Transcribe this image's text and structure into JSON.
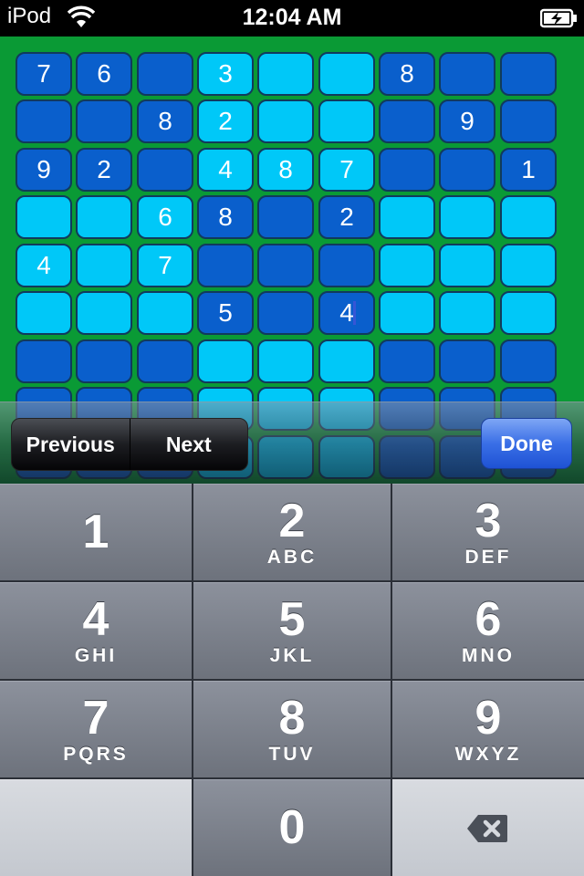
{
  "status_bar": {
    "device": "iPod",
    "time": "12:04 AM"
  },
  "board": {
    "rows": [
      [
        {
          "v": "7",
          "t": "d"
        },
        {
          "v": "6",
          "t": "d"
        },
        {
          "v": "",
          "t": "d"
        },
        {
          "v": "3",
          "t": "l"
        },
        {
          "v": "",
          "t": "l"
        },
        {
          "v": "",
          "t": "l"
        },
        {
          "v": "8",
          "t": "d"
        },
        {
          "v": "",
          "t": "d"
        },
        {
          "v": "",
          "t": "d"
        }
      ],
      [
        {
          "v": "",
          "t": "d"
        },
        {
          "v": "",
          "t": "d"
        },
        {
          "v": "8",
          "t": "d"
        },
        {
          "v": "2",
          "t": "l"
        },
        {
          "v": "",
          "t": "l"
        },
        {
          "v": "",
          "t": "l"
        },
        {
          "v": "",
          "t": "d"
        },
        {
          "v": "9",
          "t": "d"
        },
        {
          "v": "",
          "t": "d"
        }
      ],
      [
        {
          "v": "9",
          "t": "d"
        },
        {
          "v": "2",
          "t": "d"
        },
        {
          "v": "",
          "t": "d"
        },
        {
          "v": "4",
          "t": "l"
        },
        {
          "v": "8",
          "t": "l"
        },
        {
          "v": "7",
          "t": "l"
        },
        {
          "v": "",
          "t": "d"
        },
        {
          "v": "",
          "t": "d"
        },
        {
          "v": "1",
          "t": "d"
        }
      ],
      [
        {
          "v": "",
          "t": "l"
        },
        {
          "v": "",
          "t": "l"
        },
        {
          "v": "6",
          "t": "l"
        },
        {
          "v": "8",
          "t": "d"
        },
        {
          "v": "",
          "t": "d"
        },
        {
          "v": "2",
          "t": "d"
        },
        {
          "v": "",
          "t": "l"
        },
        {
          "v": "",
          "t": "l"
        },
        {
          "v": "",
          "t": "l"
        }
      ],
      [
        {
          "v": "4",
          "t": "l"
        },
        {
          "v": "",
          "t": "l"
        },
        {
          "v": "7",
          "t": "l"
        },
        {
          "v": "",
          "t": "d"
        },
        {
          "v": "",
          "t": "d"
        },
        {
          "v": "",
          "t": "d"
        },
        {
          "v": "",
          "t": "l"
        },
        {
          "v": "",
          "t": "l"
        },
        {
          "v": "",
          "t": "l"
        }
      ],
      [
        {
          "v": "",
          "t": "l"
        },
        {
          "v": "",
          "t": "l"
        },
        {
          "v": "",
          "t": "l"
        },
        {
          "v": "5",
          "t": "d"
        },
        {
          "v": "",
          "t": "d"
        },
        {
          "v": "4",
          "t": "d",
          "active": true
        },
        {
          "v": "",
          "t": "l"
        },
        {
          "v": "",
          "t": "l"
        },
        {
          "v": "",
          "t": "l"
        }
      ],
      [
        {
          "v": "",
          "t": "d"
        },
        {
          "v": "",
          "t": "d"
        },
        {
          "v": "",
          "t": "d"
        },
        {
          "v": "",
          "t": "l"
        },
        {
          "v": "",
          "t": "l"
        },
        {
          "v": "",
          "t": "l"
        },
        {
          "v": "",
          "t": "d"
        },
        {
          "v": "",
          "t": "d"
        },
        {
          "v": "",
          "t": "d"
        }
      ],
      [
        {
          "v": "",
          "t": "d"
        },
        {
          "v": "",
          "t": "d"
        },
        {
          "v": "",
          "t": "d"
        },
        {
          "v": "",
          "t": "l"
        },
        {
          "v": "",
          "t": "l"
        },
        {
          "v": "",
          "t": "l"
        },
        {
          "v": "",
          "t": "d"
        },
        {
          "v": "",
          "t": "d"
        },
        {
          "v": "",
          "t": "d"
        }
      ],
      [
        {
          "v": "",
          "t": "d"
        },
        {
          "v": "",
          "t": "d"
        },
        {
          "v": "",
          "t": "d"
        },
        {
          "v": "",
          "t": "l"
        },
        {
          "v": "",
          "t": "l"
        },
        {
          "v": "",
          "t": "l"
        },
        {
          "v": "",
          "t": "d"
        },
        {
          "v": "",
          "t": "d"
        },
        {
          "v": "",
          "t": "d"
        }
      ]
    ],
    "colors": {
      "dark": "#0a5fcc",
      "light": "#00c8f8",
      "background": "#0a9a35"
    }
  },
  "accessory": {
    "previous_label": "Previous",
    "next_label": "Next",
    "done_label": "Done"
  },
  "keypad": {
    "keys": [
      {
        "num": "1",
        "letters": ""
      },
      {
        "num": "2",
        "letters": "ABC"
      },
      {
        "num": "3",
        "letters": "DEF"
      },
      {
        "num": "4",
        "letters": "GHI"
      },
      {
        "num": "5",
        "letters": "JKL"
      },
      {
        "num": "6",
        "letters": "MNO"
      },
      {
        "num": "7",
        "letters": "PQRS"
      },
      {
        "num": "8",
        "letters": "TUV"
      },
      {
        "num": "9",
        "letters": "WXYZ"
      },
      {
        "num": "0",
        "letters": ""
      }
    ],
    "delete_icon": "backspace-icon"
  }
}
